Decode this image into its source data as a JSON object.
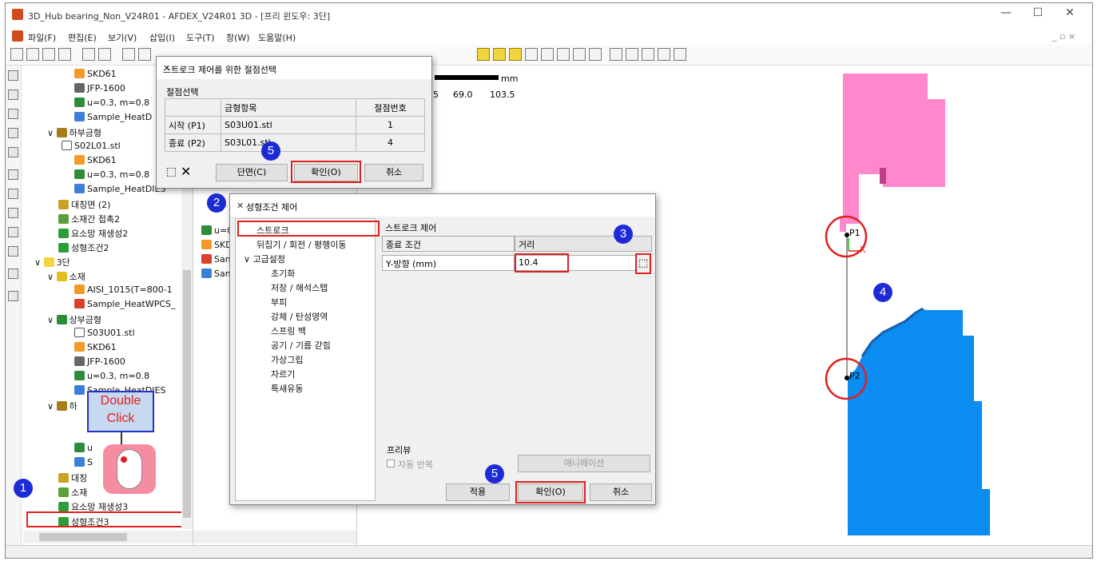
{
  "window": {
    "title": "3D_Hub bearing_Non_V24R01 - AFDEX_V24R01 3D - [프리 윈도우: 3단]",
    "min": "—",
    "max": "☐",
    "close": "✕"
  },
  "menu": [
    "파일(F)",
    "편집(E)",
    "보기(V)",
    "삽입(I)",
    "도구(T)",
    "창(W)",
    "도움말(H)"
  ],
  "mdi_controls": "_ ▫ ×",
  "tree_left": [
    "SKD61",
    "JFP-1600",
    "u=0.3, m=0.8",
    "Sample_HeatD",
    "하부금형",
    "S02L01.stl",
    "SKD61",
    "u=0.3, m=0.8",
    "Sample_HeatDIES",
    "대칭면 (2)",
    "소재간 접촉2",
    "요소망 재생성2",
    "성형조건2",
    "3단",
    "소재",
    "AISI_1015(T=800-1",
    "Sample_HeatWPCS_",
    "상부금형",
    "S03U01.stl",
    "SKD61",
    "JFP-1600",
    "u=0.3, m=0.8",
    "Sample_HeatDIES",
    "하",
    "",
    "",
    "u",
    "S",
    "대칭",
    "소재",
    "요소망 재생성3",
    "성형조건3"
  ],
  "tree_mid": [
    "",
    "u=0",
    "SKD",
    "Sam",
    "Sam"
  ],
  "scale": {
    "unit": "mm",
    "ticks": [
      "5",
      "69.0",
      "103.5"
    ]
  },
  "dlg_node": {
    "title": "스트로크 제어를 위한 절점선택",
    "group": "절점선택",
    "headers": [
      "",
      "금형항목",
      "절점번호"
    ],
    "rows": [
      [
        "시작 (P1)",
        "S03U01.stl",
        "1"
      ],
      [
        "종료 (P2)",
        "S03L01.stl",
        "4"
      ]
    ],
    "btn_section": "단면(C)",
    "btn_ok": "확인(O)",
    "btn_cancel": "취소"
  },
  "dlg_cond": {
    "title": "성형조건 제어",
    "tree": [
      "스트로크",
      "뒤집기 / 회전 / 평행이동",
      "고급설정",
      "초기화",
      "저장 / 해석스텝",
      "부피",
      "강체 / 탄성영역",
      "스프링 백",
      "공기 / 기름 갇힘",
      "가상그립",
      "자르기",
      "특새유동"
    ],
    "group_stroke": "스트로크 제어",
    "end_cond_label": "종료 조건",
    "end_cond_value": "거리",
    "dir_label": "Y-방향 (mm)",
    "dir_value": "10.4",
    "preview_group": "프리뷰",
    "auto_repeat": "자동 반복",
    "animation": "애니메이션",
    "btn_apply": "적용",
    "btn_ok": "확인(O)",
    "btn_cancel": "취소"
  },
  "callout": {
    "line1": "Double",
    "line2": "Click"
  },
  "badges": {
    "b1": "1",
    "b2": "2",
    "b3": "3",
    "b4": "4",
    "b5": "5"
  },
  "points": {
    "p1": "P1",
    "p2": "P2",
    "x": "X"
  },
  "colors": {
    "upper_die": "#ff88cc",
    "lower_die": "#0a8cf0",
    "badge": "#1d2bd6",
    "highlight": "#e02020"
  }
}
